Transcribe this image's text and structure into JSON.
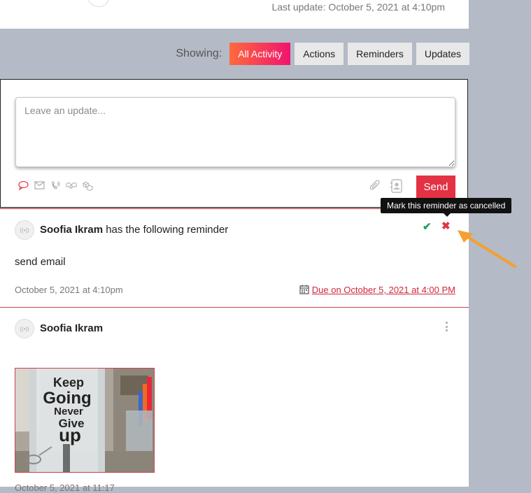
{
  "header": {
    "last_update": "Last update: October 5, 2021 at 4:10pm"
  },
  "filters": {
    "label": "Showing:",
    "options": [
      "All Activity",
      "Actions",
      "Reminders",
      "Updates"
    ],
    "active": "All Activity"
  },
  "composer": {
    "placeholder": "Leave an update...",
    "type_icons": [
      "comment-icon",
      "email-icon",
      "phone-icon",
      "handshake-icon",
      "cubes-icon"
    ],
    "attach_icon": "paperclip-icon",
    "contact_icon": "contact-card-icon",
    "send_label": "Send"
  },
  "reminder_entry": {
    "author": "Soofia Ikram",
    "action_text": "has the following reminder",
    "body": "send email",
    "timestamp": "October 5, 2021 at 4:10pm",
    "due": "Due on October 5, 2021 at 4:00 PM",
    "tooltip": "Mark this reminder as cancelled"
  },
  "photo_entry": {
    "author": "Soofia Ikram",
    "image_text": [
      "Keep",
      "Going",
      "Never",
      "Give",
      "up"
    ],
    "timestamp_partial": "October 5, 2021 at 11:17"
  },
  "colors": {
    "accent_red": "#e33244",
    "check_green": "#20a060",
    "arrow_orange": "#f5a030",
    "page_bg": "#b4bac6"
  }
}
